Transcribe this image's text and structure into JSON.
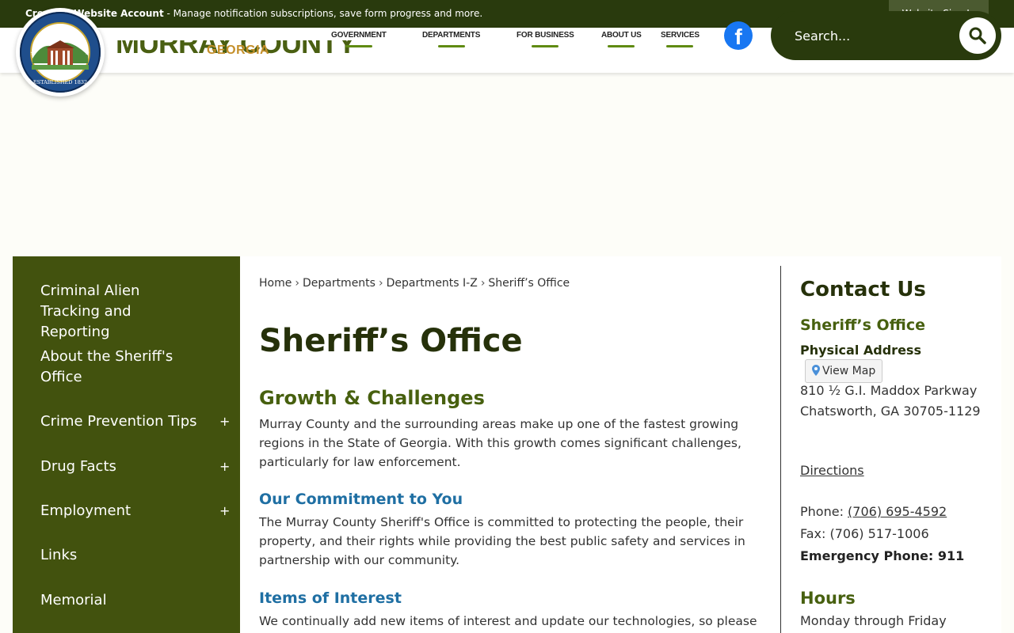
{
  "topbar": {
    "create_account": "Create a Website Account",
    "message": " - Manage notification subscriptions, save form progress and more.",
    "sign_in": "Website Sign In"
  },
  "header": {
    "logo_title": "MURRAY COUNTY",
    "logo_subtitle": "GEORGIA",
    "seal_text": "ESTABLISHED 1832",
    "nav": [
      "GOVERNMENT",
      "DEPARTMENTS",
      "FOR BUSINESS",
      "ABOUT US",
      "SERVICES"
    ],
    "search_placeholder": "Search..."
  },
  "sidebar": {
    "items": [
      {
        "label": "Criminal Alien Tracking and Reporting",
        "expand": ""
      },
      {
        "label": "About the Sheriff's Office",
        "expand": ""
      },
      {
        "label": "Crime Prevention Tips",
        "expand": "+"
      },
      {
        "label": "Drug Facts",
        "expand": "+"
      },
      {
        "label": "Employment",
        "expand": "+"
      },
      {
        "label": "Links",
        "expand": ""
      },
      {
        "label": "Memorial",
        "expand": ""
      }
    ]
  },
  "breadcrumb": [
    "Home",
    "Departments",
    "Departments I-Z",
    "Sheriff’s Office"
  ],
  "main": {
    "title": "Sheriff’s Office",
    "sections": [
      {
        "heading": "Growth & Challenges",
        "body": "Murray County and the surrounding areas make up one of the fastest growing regions in the State of Georgia. With this growth comes significant challenges, particularly for law enforcement."
      },
      {
        "heading": "Our Commitment to You",
        "body": "The Murray County Sheriff's Office is committed to protecting the people, their property, and their rights while providing the best public safety and services in partnership with our community."
      },
      {
        "heading": "Items of Interest",
        "body": "We continually add new items of interest and update our technologies, so please"
      }
    ]
  },
  "contact": {
    "title": "Contact Us",
    "department": "Sheriff’s Office",
    "address_label": "Physical Address",
    "map_button": "View Map",
    "address_line1": "810 ½ G.I. Maddox Parkway",
    "address_line2": "Chatsworth, GA 30705-1129",
    "directions": "Directions",
    "phone_label": "Phone: ",
    "phone": "(706) 695-4592",
    "fax": "Fax: (706) 517-1006",
    "emergency": "Emergency Phone: 911",
    "hours_title": "Hours",
    "hours_line": "Monday through Friday"
  },
  "colors": {
    "dark_green": "#293a0d",
    "sidebar_green": "#42520e",
    "heading_green": "#47600f",
    "link_blue": "#1f6fa3",
    "gold": "#c48f2a",
    "facebook": "#1877f2"
  },
  "icons": [
    "seal-logo",
    "facebook-icon",
    "search-icon",
    "map-pin-icon",
    "plus-icon"
  ]
}
